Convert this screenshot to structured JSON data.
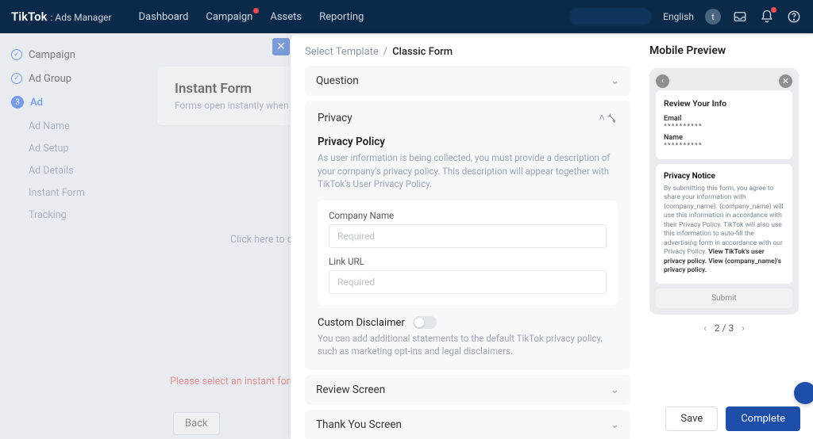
{
  "brand": {
    "name": "TikTok",
    "suffix": ": Ads Manager"
  },
  "topnav": [
    "Dashboard",
    "Campaign",
    "Assets",
    "Reporting"
  ],
  "lang": "English",
  "avatar_initial": "t",
  "steps": {
    "campaign": "Campaign",
    "adgroup": "Ad Group",
    "ad_num": "3",
    "ad": "Ad",
    "subs": [
      "Ad Name",
      "Ad Setup",
      "Ad Details",
      "Instant Form",
      "Tracking"
    ]
  },
  "bgcard": {
    "title": "Instant Form",
    "desc": "Forms open instantly when someone",
    "click_hint": "Click here to c",
    "error": "Please select an instant form in o",
    "back": "Back"
  },
  "crumb": {
    "parent": "Select Template",
    "sep": "/",
    "current": "Classic Form"
  },
  "sections": {
    "question": "Question",
    "privacy": "Privacy",
    "review": "Review Screen",
    "thank": "Thank You Screen"
  },
  "privacy": {
    "title": "Privacy Policy",
    "desc": "As user information is being collected, you must provide a description of your company's privacy policy. This description will appear together with TikTok's User Privacy Policy.",
    "company_label": "Company Name",
    "company_ph": "Required",
    "url_label": "Link URL",
    "url_ph": "Required",
    "disc_title": "Custom Disclaimer",
    "disc_desc": "You can add additional statements to the default TikTok privacy policy, such as marketing opt-ins and legal disclaimers."
  },
  "preview": {
    "title": "Mobile Preview",
    "review_title": "Review Your Info",
    "email_lbl": "Email",
    "email_val": "**********",
    "name_lbl": "Name",
    "name_val": "**********",
    "notice_title": "Privacy Notice",
    "notice_body_1": "By submitting this form, you agree to share your information with {company_name}. {company_name} will use this information in accordance with their Privacy Policy. TikTok will also use this information to auto-fill the advertising form in accordance with our Privacy Policy. ",
    "notice_link1": "View TikTok's user privacy policy.",
    "notice_link2": "View {company_name}'s privacy policy.",
    "submit": "Submit",
    "page": "2 / 3"
  },
  "footer": {
    "save": "Save",
    "complete": "Complete"
  }
}
